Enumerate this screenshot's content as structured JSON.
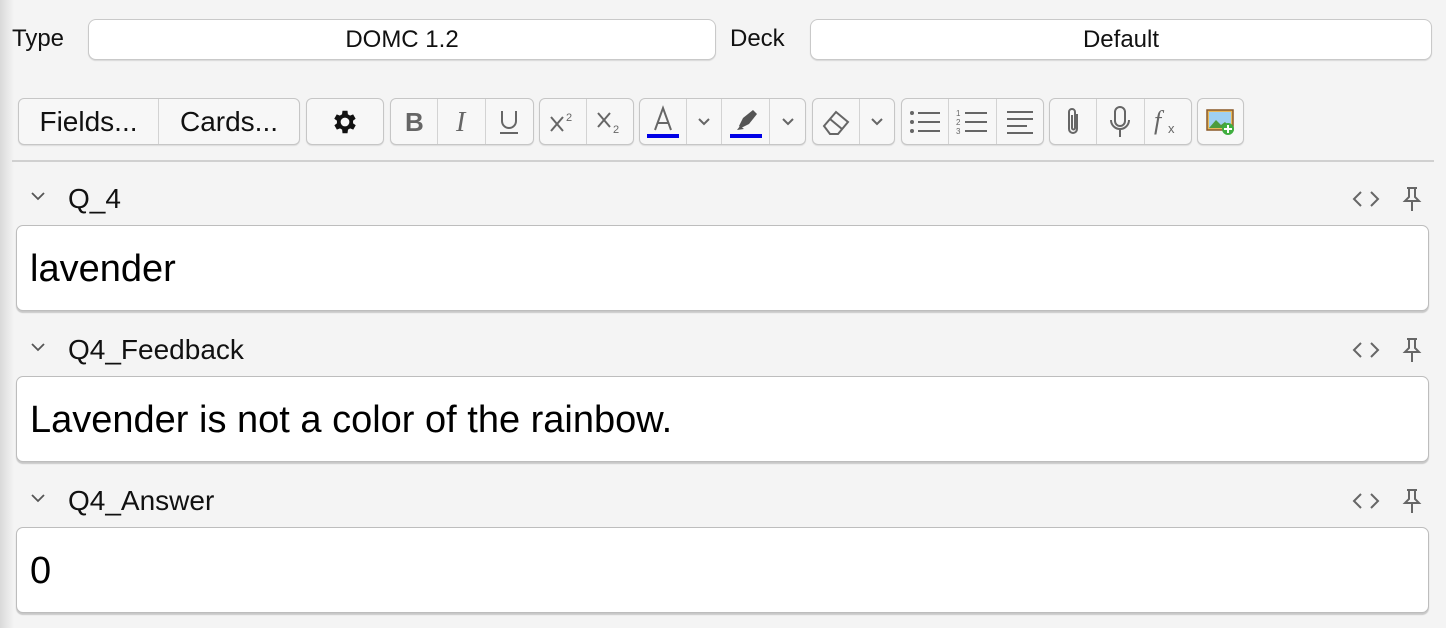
{
  "header": {
    "type_label": "Type",
    "type_value": "DOMC 1.2",
    "deck_label": "Deck",
    "deck_value": "Default"
  },
  "toolbar": {
    "fields_label": "Fields...",
    "cards_label": "Cards...",
    "text_color_accent": "#0000e6",
    "highlight_color_accent": "#0000e6",
    "icons": [
      "gear-icon",
      "bold-icon",
      "italic-icon",
      "underline-icon",
      "superscript-icon",
      "subscript-icon",
      "text-color-icon",
      "highlight-icon",
      "eraser-icon",
      "bullet-list-icon",
      "numbered-list-icon",
      "align-icon",
      "paperclip-icon",
      "microphone-icon",
      "formula-icon",
      "image-occlusion-icon"
    ]
  },
  "fields": [
    {
      "name": "Q_4",
      "value": "lavender"
    },
    {
      "name": "Q4_Feedback",
      "value": "Lavender is not a color of the rainbow."
    },
    {
      "name": "Q4_Answer",
      "value": "0"
    }
  ]
}
